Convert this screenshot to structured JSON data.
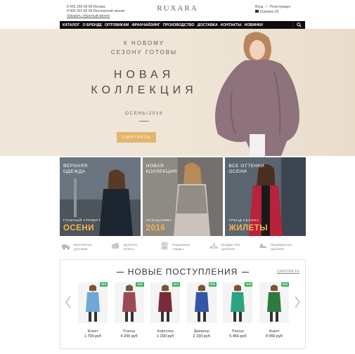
{
  "header": {
    "phone1": "8 495 268 08 08 Москва",
    "phone2": "8 800 302 68 08 Бесплатный звонок",
    "callback": "Заказать обратный звонок",
    "logo": "RUXARA",
    "login": "Вход",
    "separator": "/",
    "register": "Регистрация",
    "cart": "Корзина (0)"
  },
  "nav": {
    "items": [
      "КАТАЛОГ",
      "О БРЕНДЕ",
      "ОПТОВИКАМ",
      "ФРАНЧАЙЗИНГ",
      "ПРОИЗВОДСТВО",
      "ДОСТАВКА",
      "КОНТАКТЫ",
      "НОВИНКИ"
    ]
  },
  "hero": {
    "sub1": "К НОВОМУ",
    "sub2": "СЕЗОНУ ГОТОВЫ",
    "title1": "НОВАЯ",
    "title2": "КОЛЛЕКЦИЯ",
    "season": "ОСЕНЬ/2016",
    "button": "СМОТРЕТЬ"
  },
  "tiles": [
    {
      "top1": "ВЕРХНЯЯ",
      "top2": "ОДЕЖДА",
      "small": "ГЛАВНЫЙ АТРИБУТ",
      "big": "ОСЕНИ",
      "bg": "#5d6670"
    },
    {
      "top1": "НОВАЯ",
      "top2": "КОЛЛЕКЦИЯ",
      "small": "ОСЕНЬ/ЗИМА",
      "big": "2016",
      "bg": "#6c6864"
    },
    {
      "top1": "ВСЕ ОТТЕНКИ",
      "top2": "ОСЕНИ",
      "small": "ТРЕНД СЕЗОНА",
      "big": "ЖИЛЕТЫ",
      "bg": "#55606a"
    }
  ],
  "features": [
    {
      "l1": "Бесплатная",
      "l2": "доставка"
    },
    {
      "l1": "Удобство",
      "l2": "оплаты"
    },
    {
      "l1": "Подлинные",
      "l2": "товары"
    },
    {
      "l1": "Возврат без",
      "l2": "проблем"
    },
    {
      "l1": "Примерка без",
      "l2": "проблем"
    }
  ],
  "arrivals": {
    "title": "НОВЫЕ ПОСТУПЛЕНИЯ",
    "all": "СМОТРЕТЬ",
    "badge": "NEW",
    "products": [
      {
        "name": "Жакет",
        "price": "1 700 руб",
        "color": "#6fa7d8"
      },
      {
        "name": "Платье",
        "price": "4 200 руб",
        "color": "#9b4b58"
      },
      {
        "name": "Кофточка",
        "price": "1 200 руб",
        "color": "#7a2b3a"
      },
      {
        "name": "Джемпер",
        "price": "2 150 руб",
        "color": "#3456a8"
      },
      {
        "name": "Платье",
        "price": "5 450 руб",
        "color": "#2ba384"
      },
      {
        "name": "Жакет",
        "price": "4 950 руб",
        "color": "#2f7a3d"
      }
    ]
  }
}
